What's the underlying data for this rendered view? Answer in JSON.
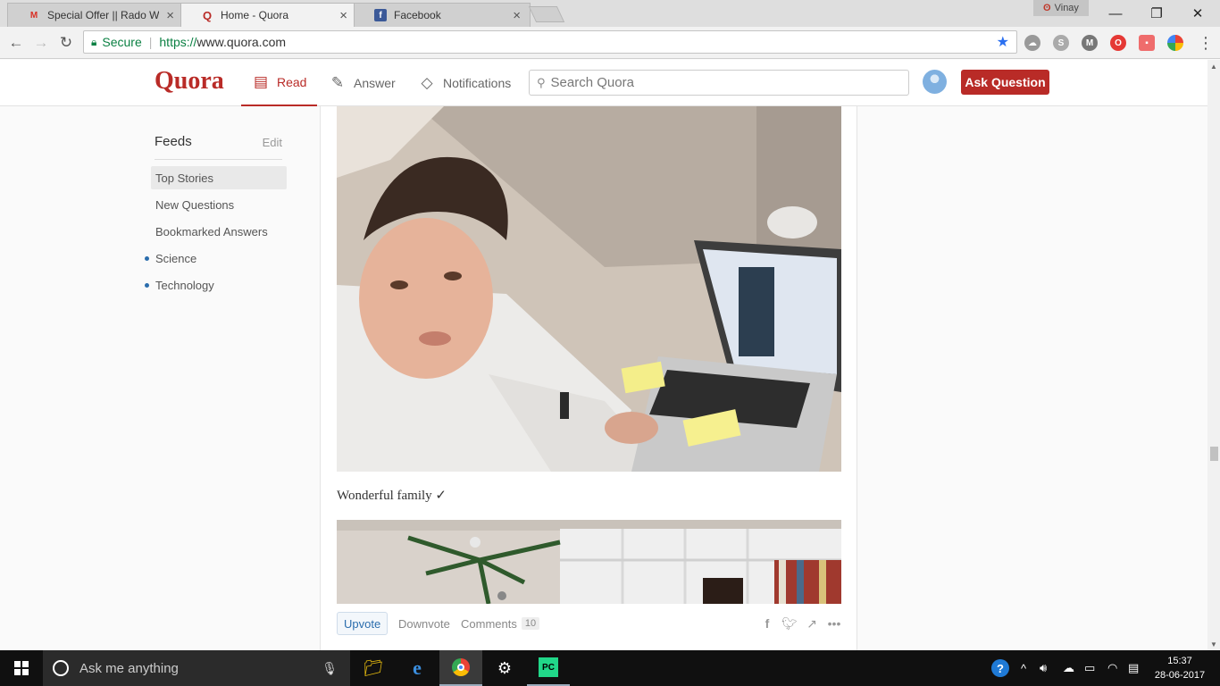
{
  "browser": {
    "tabs": [
      {
        "title": "Special Offer || Rado Wat",
        "icon": "gmail-icon",
        "active": false
      },
      {
        "title": "Home - Quora",
        "icon": "quora-icon",
        "active": true
      },
      {
        "title": "Facebook",
        "icon": "facebook-icon",
        "active": false
      }
    ],
    "profile_name": "Vinay",
    "secure_label": "Secure",
    "url_scheme": "https://",
    "url_host": "www.quora.com"
  },
  "quora": {
    "logo": "Quora",
    "nav": [
      {
        "label": "Read",
        "icon": "read-icon",
        "active": true
      },
      {
        "label": "Answer",
        "icon": "answer-icon",
        "active": false
      },
      {
        "label": "Notifications",
        "icon": "notifications-icon",
        "active": false
      }
    ],
    "search_placeholder": "Search Quora",
    "ask_button": "Ask Question",
    "accent_color": "#b92b27"
  },
  "sidebar": {
    "title": "Feeds",
    "edit": "Edit",
    "items": [
      {
        "label": "Top Stories",
        "selected": true,
        "dot": false
      },
      {
        "label": "New Questions",
        "selected": false,
        "dot": false
      },
      {
        "label": "Bookmarked Answers",
        "selected": false,
        "dot": false
      },
      {
        "label": "Science",
        "selected": false,
        "dot": true
      },
      {
        "label": "Technology",
        "selected": false,
        "dot": true
      }
    ]
  },
  "post": {
    "caption": "Wonderful family ✓",
    "actions": {
      "upvote": "Upvote",
      "downvote": "Downvote",
      "comments": "Comments",
      "comments_count": "10"
    }
  },
  "taskbar": {
    "search_placeholder": "Ask me anything",
    "time": "15:37",
    "date": "28-06-2017"
  }
}
